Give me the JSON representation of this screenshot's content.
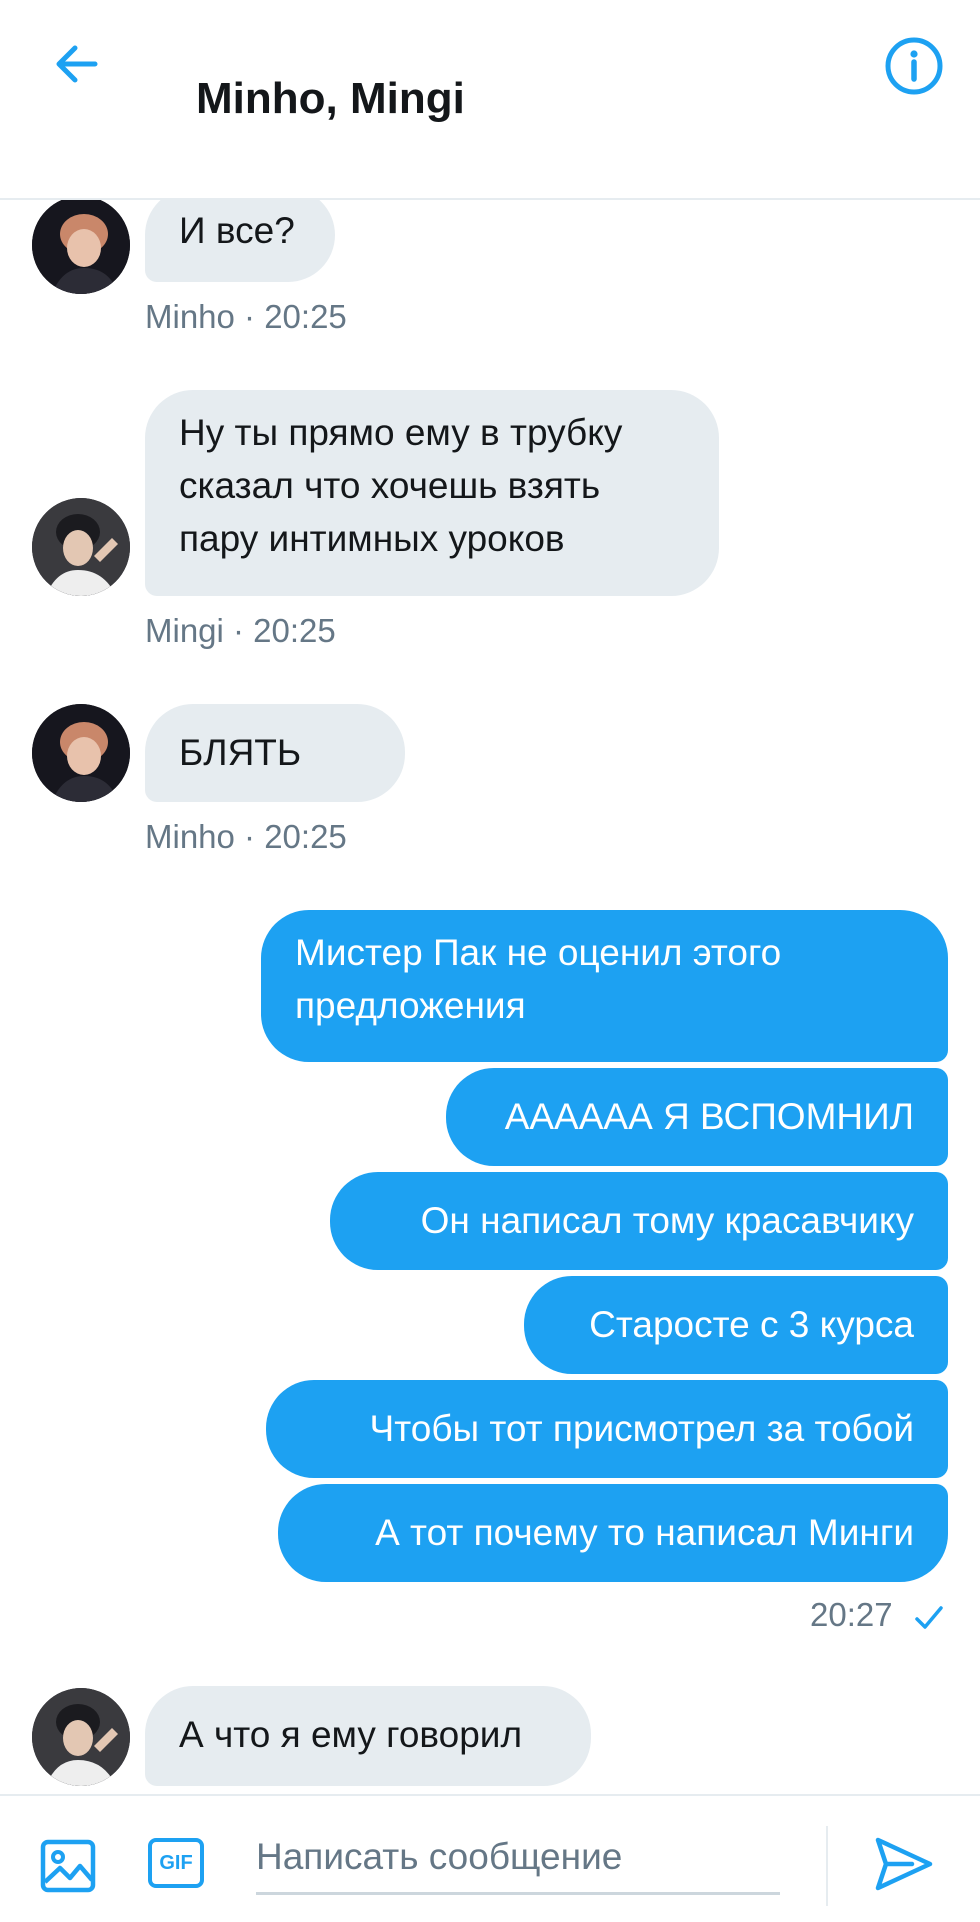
{
  "header": {
    "title": "Minho, Mingi",
    "back_icon": "arrow-left-icon",
    "info_icon": "info-circle-icon"
  },
  "colors": {
    "accent": "#1da1f2",
    "incoming_bubble": "#e6ecf0",
    "meta_text": "#657786"
  },
  "messages": {
    "m1": {
      "text": "И все?",
      "meta": "Minho · 20:25"
    },
    "m2": {
      "text": "Ну ты прямо ему в трубку\nсказал что хочешь взять\nпару интимных уроков",
      "meta": "Mingi · 20:25"
    },
    "m3": {
      "text": "БЛЯТЬ",
      "meta": "Minho · 20:25"
    },
    "o1": {
      "text": "Мистер Пак не оценил этого\nпредложения"
    },
    "o2": {
      "text": "АААААА Я ВСПОМНИЛ"
    },
    "o3": {
      "text": "Он написал тому красавчику"
    },
    "o4": {
      "text": "Старосте с 3 курса"
    },
    "o5": {
      "text": "Чтобы тот присмотрел за тобой"
    },
    "o6": {
      "text": "А тот почему то написал Минги"
    },
    "out_time": "20:27",
    "m4": {
      "text": "А что я ему говорил"
    }
  },
  "composer": {
    "placeholder": "Написать сообщение",
    "gif_label": "GIF",
    "image_icon": "image-icon",
    "send_icon": "send-icon"
  }
}
